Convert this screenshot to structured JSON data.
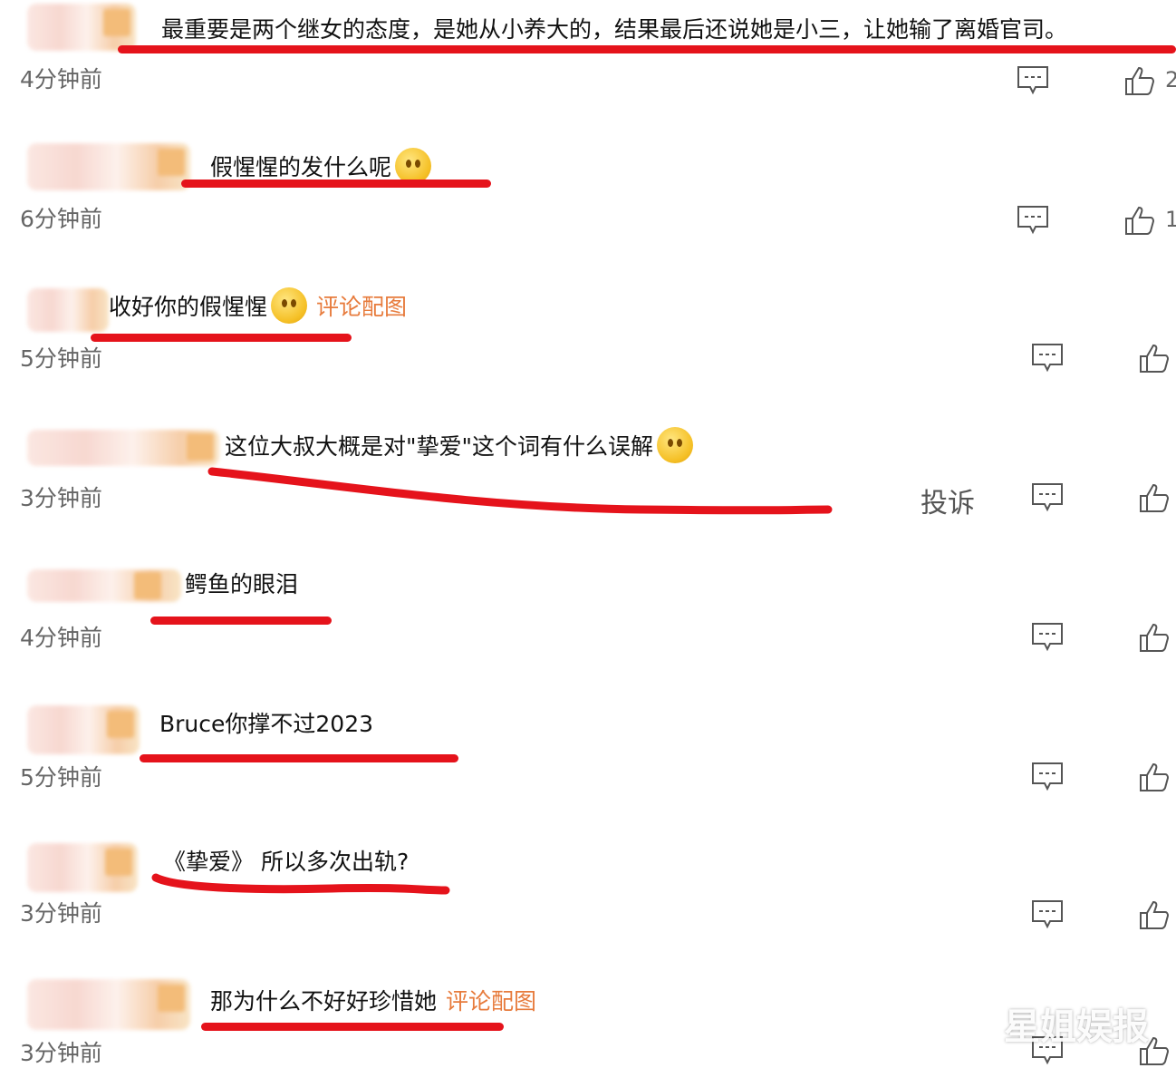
{
  "comments": [
    {
      "text": "最重要是两个继女的态度，是她从小养大的，结果最后还说她是小三，让她输了离婚官司。",
      "time": "4分钟前",
      "like_count": "2"
    },
    {
      "text": "假惺惺的发什么呢",
      "time": "6分钟前",
      "like_count": "1"
    },
    {
      "text": "收好你的假惺惺",
      "pic_label": "评论配图",
      "time": "5分钟前"
    },
    {
      "text": "这位大叔大概是对\"挚爱\"这个词有什么误解",
      "time": "3分钟前",
      "complain": "投诉"
    },
    {
      "text": "鳄鱼的眼泪",
      "time": "4分钟前"
    },
    {
      "text": "Bruce你撑不过2023",
      "time": "5分钟前"
    },
    {
      "text": "《挚爱》 所以多次出轨?",
      "time": "3分钟前"
    },
    {
      "text": "那为什么不好好珍惜她",
      "pic_label": "评论配图",
      "time": "3分钟前"
    }
  ],
  "watermark": "星姐娱报",
  "colors": {
    "underline": "#e5131b",
    "pic_label": "#e77b3c",
    "time": "#666666"
  }
}
